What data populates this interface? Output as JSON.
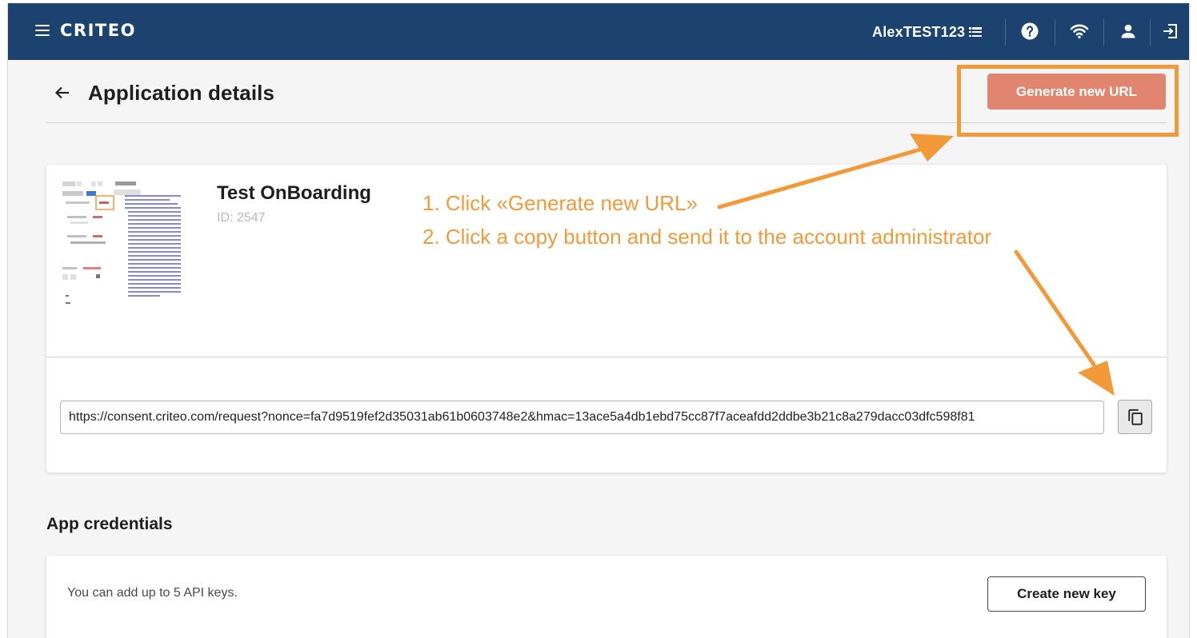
{
  "topbar": {
    "logo": "CRITEO",
    "account_name": "AlexTEST123",
    "icons": [
      "menu-icon",
      "list-icon",
      "help-icon",
      "wifi-icon",
      "user-icon",
      "logout-icon"
    ]
  },
  "header": {
    "title": "Application details",
    "generate_button": "Generate new URL"
  },
  "app": {
    "name": "Test OnBoarding",
    "id": "ID: 2547",
    "consent_url": "https://consent.criteo.com/request?nonce=fa7d9519fef2d35031ab61b0603748e2&hmac=13ace5a4db1ebd75cc87f7aceafdd2ddbe3b21c8a279dacc03dfc598f81"
  },
  "credentials": {
    "title": "App credentials",
    "description": "You can add up to 5 API keys.",
    "create_button": "Create new key"
  },
  "annotations": {
    "step1": "1. Click «Generate new URL»",
    "step2": "2. Click a copy button and send it to the account administrator",
    "color": "#f2993a"
  },
  "colors": {
    "topbar": "#1c4370",
    "primary_button": "#e2856f",
    "annotation": "#f2993a"
  }
}
